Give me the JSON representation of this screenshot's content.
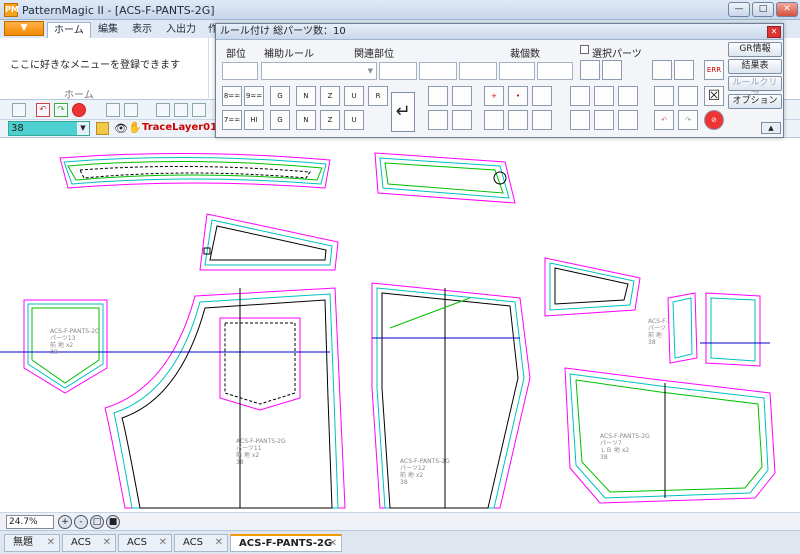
{
  "window": {
    "title": "PatternMagic II - [ACS-F-PANTS-2G]",
    "icon_text": "PM"
  },
  "ribbon": {
    "quick_access_arrow": "▼",
    "tabs": [
      {
        "label": "ホーム"
      },
      {
        "label": "編集"
      },
      {
        "label": "表示"
      },
      {
        "label": "入出力"
      },
      {
        "label": "作"
      }
    ],
    "home_group_text": "ここに好きなメニューを登録できます",
    "home_group_label": "ホーム"
  },
  "layer": {
    "value": "38",
    "name": "TraceLayer01"
  },
  "panel": {
    "title": "ルール付け 総パーツ数：10",
    "labels": {
      "part": "部位",
      "aux_rule": "補助ルール",
      "related_part": "関連部位",
      "cut_count": "裁個数",
      "selected_parts": "選択パーツ"
    },
    "buttons": {
      "gr_info": "GR情報",
      "result_table": "結果表",
      "rule_clear": "ルールクリア",
      "option": "オプション"
    },
    "rule_icons": [
      "8==",
      "9==",
      "G",
      "N",
      "Z",
      "U",
      "R",
      "7==",
      "HI",
      "G",
      "N",
      "Z",
      "U"
    ],
    "enter_glyph": "↵",
    "collapse_glyph": "▲"
  },
  "canvas": {
    "part_labels": [
      [
        "ACS-F-PANTS-2G",
        "パーツ11",
        "前 地 x2",
        "38"
      ],
      [
        "ACS-F-PANTS-2G",
        "パーツ12",
        "前 地 x2",
        "38"
      ],
      [
        "ACS-F-PANTS-2G",
        "パーツ13",
        "前 地 x2",
        "38"
      ],
      [
        "ACS-F-PANTS-2G",
        "パーツ7",
        "ＬＢ 地 x2",
        "38"
      ],
      [
        "ACS-F-",
        "パーツ",
        "前 地",
        "38"
      ]
    ]
  },
  "status": {
    "zoom": "24.7%",
    "zoom_icons": [
      "+",
      "-",
      "□",
      "■"
    ]
  },
  "doc_tabs": [
    {
      "label": "無題"
    },
    {
      "label": "ACS"
    },
    {
      "label": "ACS"
    },
    {
      "label": "ACS"
    },
    {
      "label": "ACS-F-PANTS-2G"
    }
  ],
  "colors": {
    "outline": "#ff00ff",
    "seam1": "#00c0c0",
    "seam2": "#00c000",
    "line": "#000000",
    "accent": "#f09a00"
  }
}
